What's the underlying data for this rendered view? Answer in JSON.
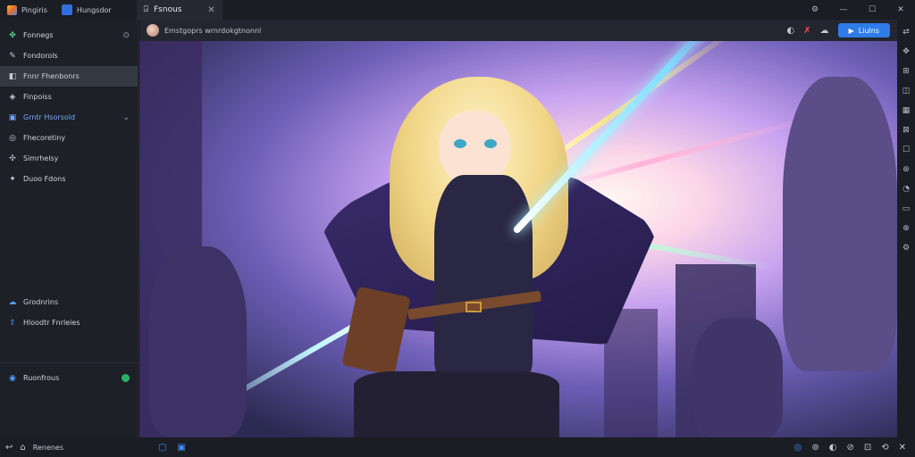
{
  "titlebar": {
    "app_name": "Pingiris",
    "tab2_label": "Hungsdor",
    "active_tab_label": "Fsnous",
    "close_glyph": "✕",
    "controls": [
      "⚙",
      "—",
      "☐",
      "✕"
    ]
  },
  "sidebar": {
    "items": [
      {
        "label": "Fonnegs",
        "icon": "puzzle-icon",
        "glyph": "✤",
        "right": "⊙"
      },
      {
        "label": "Fondorols",
        "icon": "tools-icon",
        "glyph": "✎"
      },
      {
        "label": "Fnnr Fhenbonrs",
        "icon": "game-icon",
        "glyph": "◧"
      },
      {
        "label": "Finpoiss",
        "icon": "chat-icon",
        "glyph": "◈"
      },
      {
        "label": "Grntr Hsorsold",
        "icon": "folder-icon",
        "glyph": "▣",
        "right": "⌄"
      },
      {
        "label": "Fhecoretiny",
        "icon": "settings-icon",
        "glyph": "◎"
      },
      {
        "label": "Simrhelsy",
        "icon": "shuffle-icon",
        "glyph": "✣"
      },
      {
        "label": "Duoo Fdons",
        "icon": "paw-icon",
        "glyph": "✦"
      }
    ],
    "lower_items": [
      {
        "label": "Grodnrins",
        "icon": "cloud-icon",
        "glyph": "☁"
      },
      {
        "label": "Hloodtr Fnrleies",
        "icon": "upload-icon",
        "glyph": "⇪"
      }
    ],
    "account": {
      "label": "Ruonfrous",
      "icon": "account-icon",
      "glyph": "◉"
    }
  },
  "toolbar": {
    "title": "Emstgoprs wrnrdokgtnonnl",
    "action_label": "Liulns",
    "icons": [
      "◐",
      "✗",
      "☁"
    ]
  },
  "rightrail": {
    "icons": [
      "⇄",
      "✥",
      "⊞",
      "◫",
      "▦",
      "⊠",
      "☐",
      "⊛",
      "◔",
      "▭",
      "⊕",
      "⚙"
    ]
  },
  "bottombar": {
    "back_glyph": "↩",
    "home_glyph": "⌂",
    "home_label": "Renenes",
    "mid_icons": [
      "▢",
      "▣"
    ],
    "tray": [
      "◎",
      "⊚",
      "◐",
      "⊘",
      "⊡",
      "⟲",
      "✕"
    ]
  },
  "colors": {
    "accent": "#2f7be8",
    "sidebar_bg": "#1d2027",
    "status_green": "#27b365"
  }
}
